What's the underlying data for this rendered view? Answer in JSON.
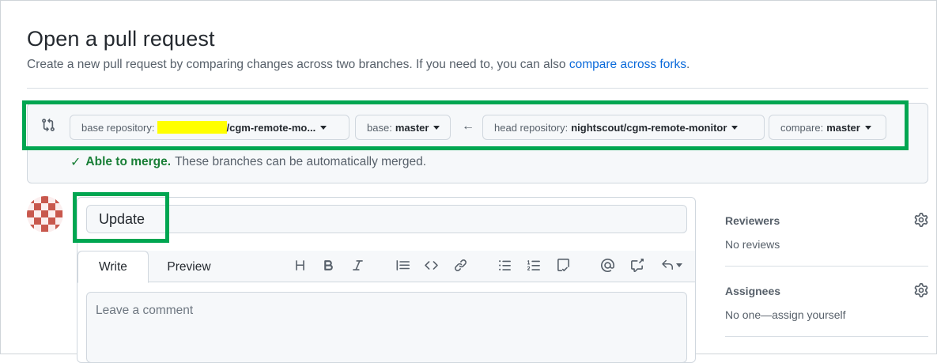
{
  "header": {
    "title": "Open a pull request",
    "subtitle_prefix": "Create a new pull request by comparing changes across two branches. If you need to, you can also ",
    "subtitle_link": "compare across forks",
    "subtitle_suffix": "."
  },
  "compare": {
    "base_repo_label": "base repository:",
    "base_repo_value": "/cgm-remote-mo...",
    "base_label": "base:",
    "base_value": "master",
    "head_repo_label": "head repository:",
    "head_repo_value": "nightscout/cgm-remote-monitor",
    "compare_label": "compare:",
    "compare_value": "master",
    "merge_status_bold": "Able to merge.",
    "merge_status_text": "These branches can be automatically merged."
  },
  "composer": {
    "title_value": "Update",
    "tab_write": "Write",
    "tab_preview": "Preview",
    "comment_placeholder": "Leave a comment"
  },
  "sidebar": {
    "reviewers_heading": "Reviewers",
    "reviewers_value": "No reviews",
    "assignees_heading": "Assignees",
    "assignees_value": "No one—assign yourself"
  },
  "colors": {
    "accent_link": "#0969da",
    "success": "#1a7f37",
    "highlight_box": "#00a651",
    "redaction": "#ffff00"
  },
  "icons": {
    "compare": "git-compare-icon",
    "arrow": "arrow-left-icon",
    "check": "check-icon",
    "gear": "gear-icon"
  }
}
